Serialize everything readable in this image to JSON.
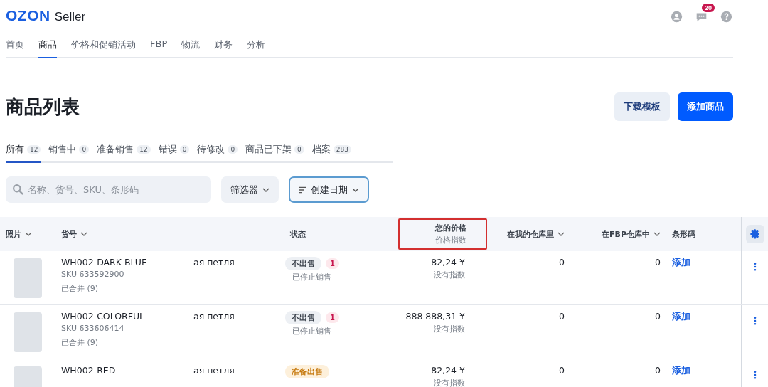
{
  "header": {
    "logo": "OZON",
    "product": "Seller",
    "notifications_badge": "20"
  },
  "nav": [
    {
      "label": "首页",
      "selected": false
    },
    {
      "label": "商品",
      "selected": true
    },
    {
      "label": "价格和促销活动",
      "selected": false
    },
    {
      "label": "FBP",
      "selected": false
    },
    {
      "label": "物流",
      "selected": false
    },
    {
      "label": "财务",
      "selected": false
    },
    {
      "label": "分析",
      "selected": false
    }
  ],
  "page_title": "商品列表",
  "buttons": [
    {
      "label": "下载模板",
      "kind": "secondary"
    },
    {
      "label": "添加商品",
      "kind": "primary"
    }
  ],
  "tabs": [
    {
      "label": "所有",
      "count": "12",
      "selected": true
    },
    {
      "label": "销售中",
      "count": "0",
      "selected": false
    },
    {
      "label": "准备销售",
      "count": "12",
      "selected": false
    },
    {
      "label": "错误",
      "count": "0",
      "selected": false
    },
    {
      "label": "待修改",
      "count": "0",
      "selected": false
    },
    {
      "label": "商品已下架",
      "count": "0",
      "selected": false
    },
    {
      "label": "档案",
      "count": "283",
      "selected": false
    }
  ],
  "search": {
    "placeholder": "名称、货号、SKU、条形码"
  },
  "filter_button": "筛选器",
  "sort_button": "创建日期",
  "table": {
    "columns": [
      {
        "label": "照片",
        "sortable": true
      },
      {
        "label": "货号",
        "sortable": true
      },
      {
        "label": "状态",
        "sortable": false
      },
      {
        "label": "您的价格",
        "sublabel": "价格指数",
        "sortable": false,
        "highlighted": true
      },
      {
        "label": "在我的仓库里",
        "sortable": true
      },
      {
        "label": "在FBP仓库中",
        "sortable": true
      },
      {
        "label": "条形码",
        "sortable": false
      }
    ],
    "rows": [
      {
        "article": "WH002-DARK BLUE",
        "sku": "SKU 633592900",
        "merged": "已合并 (9)",
        "name": "ая петля",
        "status": {
          "label": "不出售",
          "kind": "inactive"
        },
        "error_count": "1",
        "status_note": "已停止销售",
        "price": "82,24 ¥",
        "price_index": "没有指数",
        "my_stock": "0",
        "fbp_stock": "0",
        "barcode_action": "添加"
      },
      {
        "article": "WH002-COLORFUL",
        "sku": "SKU 633606414",
        "merged": "已合并 (9)",
        "name": "ая петля",
        "status": {
          "label": "不出售",
          "kind": "inactive"
        },
        "error_count": "1",
        "status_note": "已停止销售",
        "price": "888 888,31 ¥",
        "price_index": "没有指数",
        "my_stock": "0",
        "fbp_stock": "0",
        "barcode_action": "添加"
      },
      {
        "article": "WH002-RED",
        "name": "ая петля",
        "status": {
          "label": "准备出售",
          "kind": "preparing"
        },
        "price": "82,24 ¥",
        "price_index": "没有指数",
        "my_stock": "0",
        "fbp_stock": "0",
        "barcode_action": "添加"
      }
    ]
  }
}
